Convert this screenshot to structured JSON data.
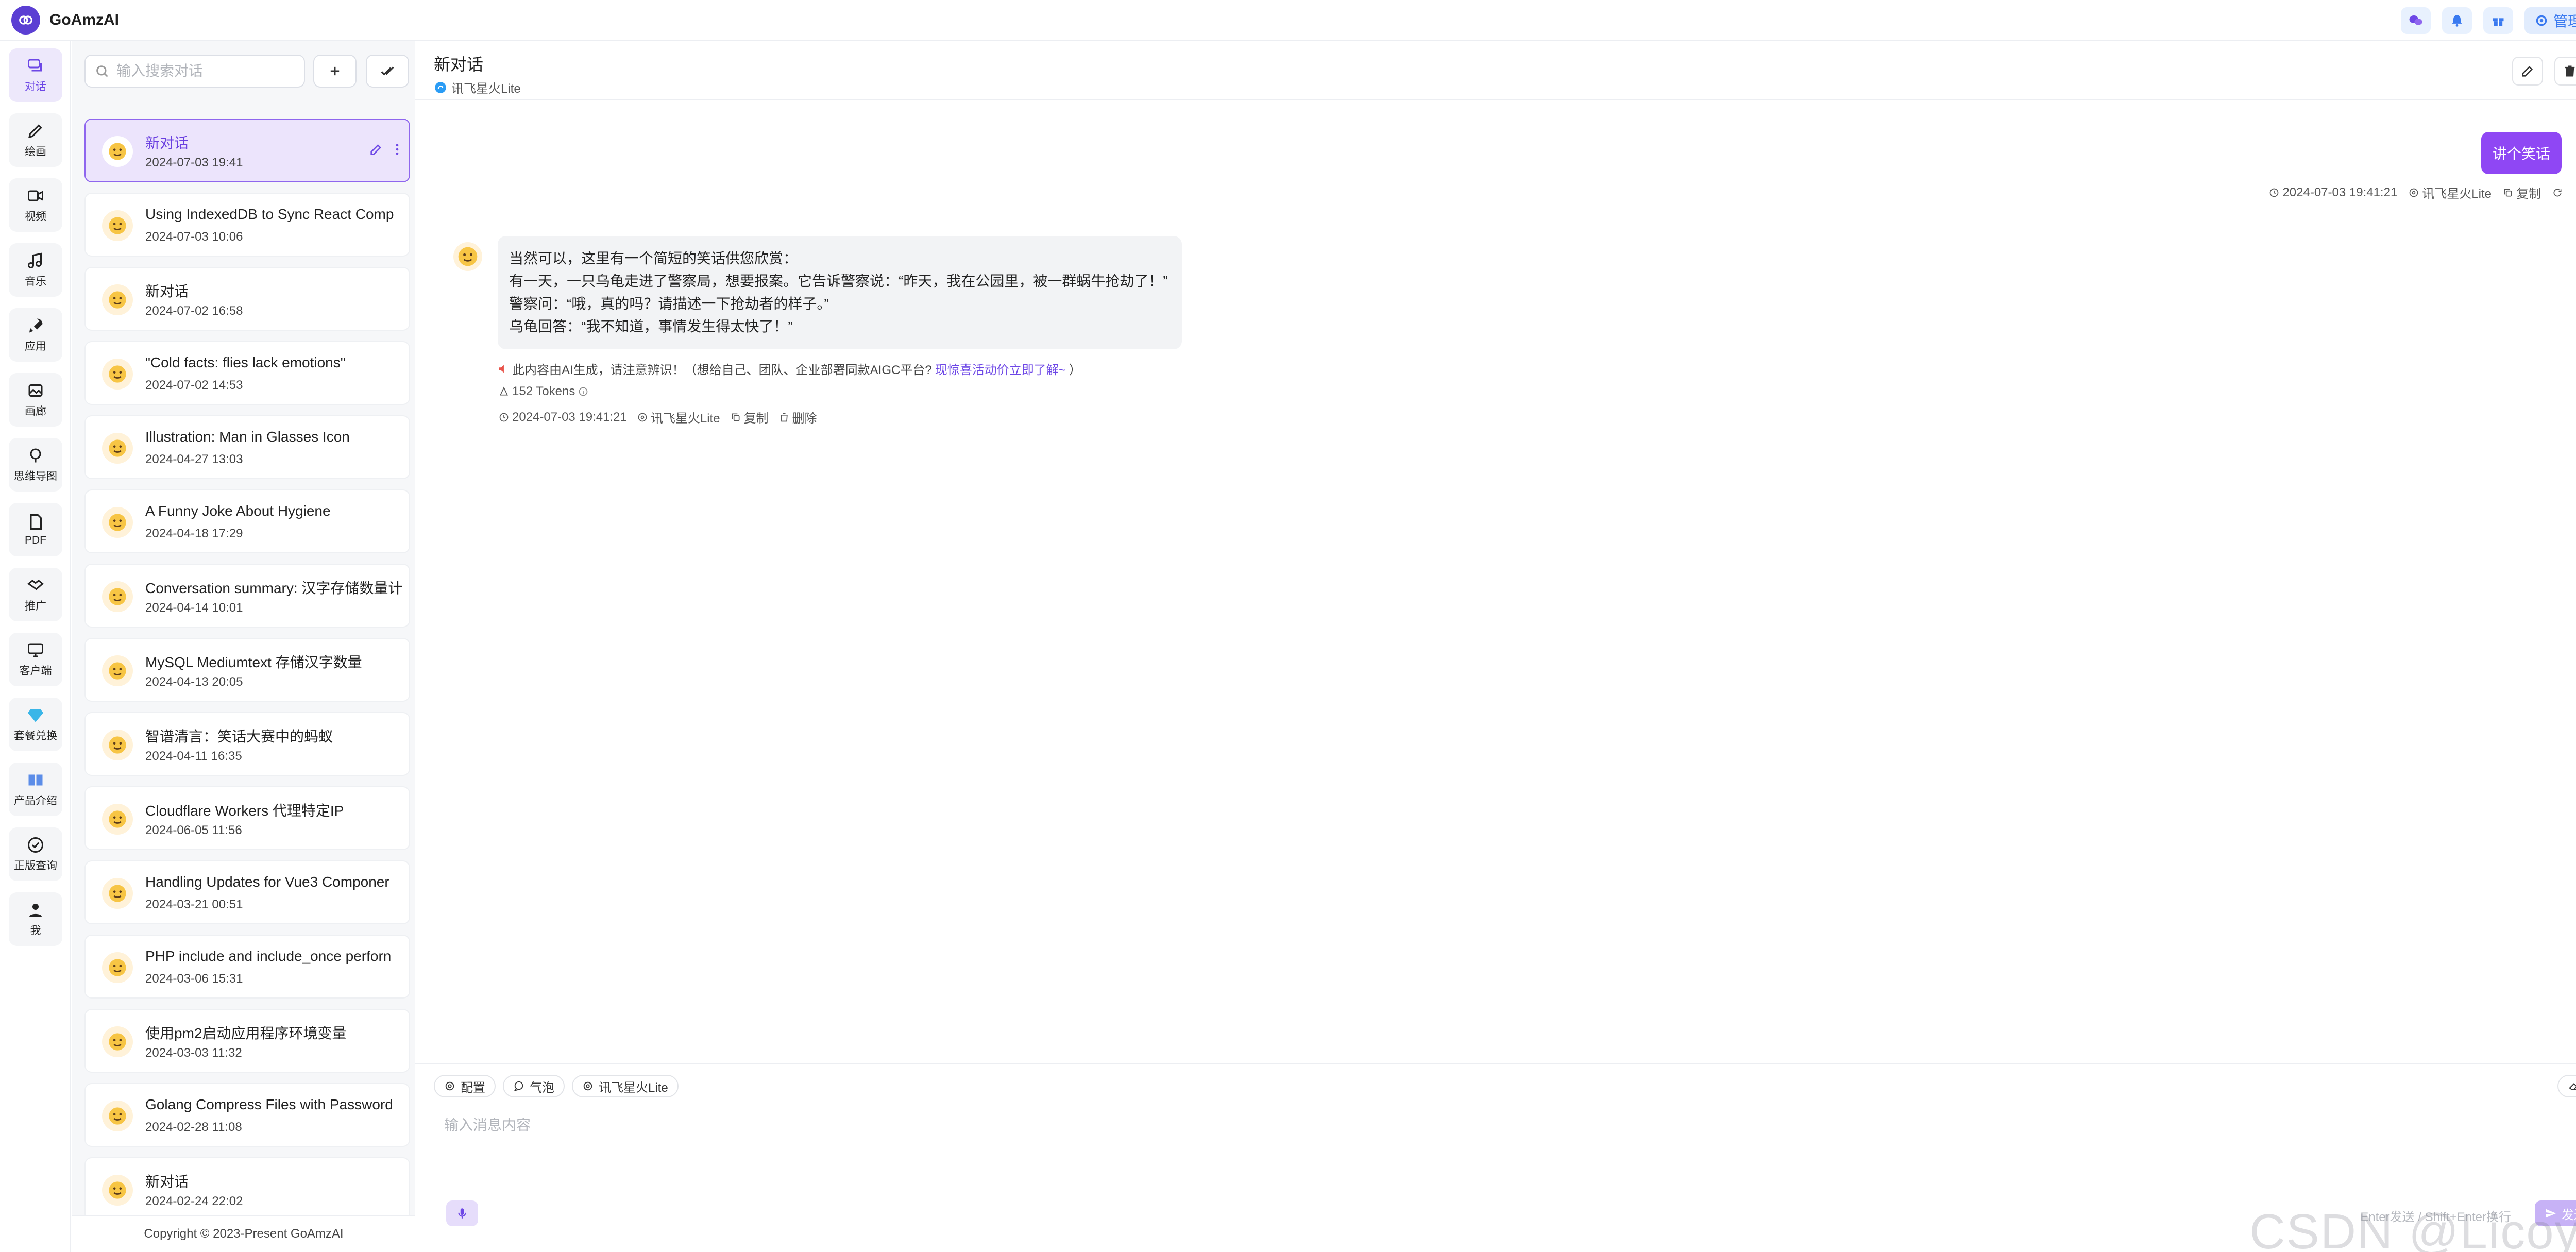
{
  "app": {
    "name": "GoAmzAI"
  },
  "topbar": {
    "admin_label": "管理"
  },
  "nav": [
    {
      "label": "对话",
      "icon": "chat-icon"
    },
    {
      "label": "绘画",
      "icon": "paint-icon"
    },
    {
      "label": "视频",
      "icon": "video-icon"
    },
    {
      "label": "音乐",
      "icon": "music-icon"
    },
    {
      "label": "应用",
      "icon": "rocket-icon"
    },
    {
      "label": "画廊",
      "icon": "gallery-icon"
    },
    {
      "label": "思维导图",
      "icon": "mindmap-icon"
    },
    {
      "label": "PDF",
      "icon": "pdf-icon"
    },
    {
      "label": "推广",
      "icon": "handshake-icon"
    },
    {
      "label": "客户端",
      "icon": "monitor-icon"
    },
    {
      "label": "套餐兑换",
      "icon": "diamond-icon"
    },
    {
      "label": "产品介绍",
      "icon": "book-icon"
    },
    {
      "label": "正版查询",
      "icon": "verified-icon"
    },
    {
      "label": "我",
      "icon": "user-icon"
    }
  ],
  "search": {
    "placeholder": "输入搜索对话"
  },
  "conversations": [
    {
      "title": "新对话",
      "date": "2024-07-03 19:41"
    },
    {
      "title": "Using IndexedDB to Sync React Comp",
      "date": "2024-07-03 10:06"
    },
    {
      "title": "新对话",
      "date": "2024-07-02 16:58"
    },
    {
      "title": "\"Cold facts: flies lack emotions\"",
      "date": "2024-07-02 14:53"
    },
    {
      "title": "Illustration: Man in Glasses Icon",
      "date": "2024-04-27 13:03"
    },
    {
      "title": "A Funny Joke About Hygiene",
      "date": "2024-04-18 17:29"
    },
    {
      "title": "Conversation summary: 汉字存储数量计",
      "date": "2024-04-14 10:01"
    },
    {
      "title": "MySQL Mediumtext 存储汉字数量",
      "date": "2024-04-13 20:05"
    },
    {
      "title": "智谱清言：笑话大赛中的蚂蚁",
      "date": "2024-04-11 16:35"
    },
    {
      "title": "Cloudflare Workers 代理特定IP",
      "date": "2024-06-05 11:56"
    },
    {
      "title": "Handling Updates for Vue3 Componer",
      "date": "2024-03-21 00:51"
    },
    {
      "title": "PHP include and include_once perforn",
      "date": "2024-03-06 15:31"
    },
    {
      "title": "使用pm2启动应用程序环境变量",
      "date": "2024-03-03 11:32"
    },
    {
      "title": "Golang Compress Files with Password",
      "date": "2024-02-28 11:08"
    },
    {
      "title": "新对话",
      "date": "2024-02-24 22:02"
    }
  ],
  "footer": {
    "copyright": "Copyright © 2023-Present GoAmzAI"
  },
  "chat": {
    "title": "新对话",
    "model": "讯飞星火Lite",
    "user_message": {
      "text": "讲个笑话",
      "time": "2024-07-03 19:41:21",
      "model": "讯飞星火Lite",
      "copy": "复制"
    },
    "ai_message": {
      "lines": [
        "当然可以，这里有一个简短的笑话供您欣赏：",
        "有一天，一只乌龟走进了警察局，想要报案。它告诉警察说：“昨天，我在公园里，被一群蜗牛抢劫了！”",
        "警察问：“哦，真的吗？请描述一下抢劫者的样子。”",
        "乌龟回答：“我不知道，事情发生得太快了！”"
      ],
      "notice": "此内容由AI生成，请注意辨识！（想给自己、团队、企业部署同款AIGC平台?",
      "notice_link": "现惊喜活动价立即了解~",
      "notice_end": "）",
      "tokens": "152 Tokens",
      "time": "2024-07-03 19:41:21",
      "model": "讯飞星火Lite",
      "copy": "复制",
      "delete": "删除"
    }
  },
  "composer": {
    "config": "配置",
    "bubble": "气泡",
    "model": "讯飞星火Lite",
    "clear": "清空",
    "placeholder": "输入消息内容",
    "hint": "Enter发送 / Shift+Enter换行",
    "send": "发送"
  },
  "watermark": "CSDN @Licoyn"
}
